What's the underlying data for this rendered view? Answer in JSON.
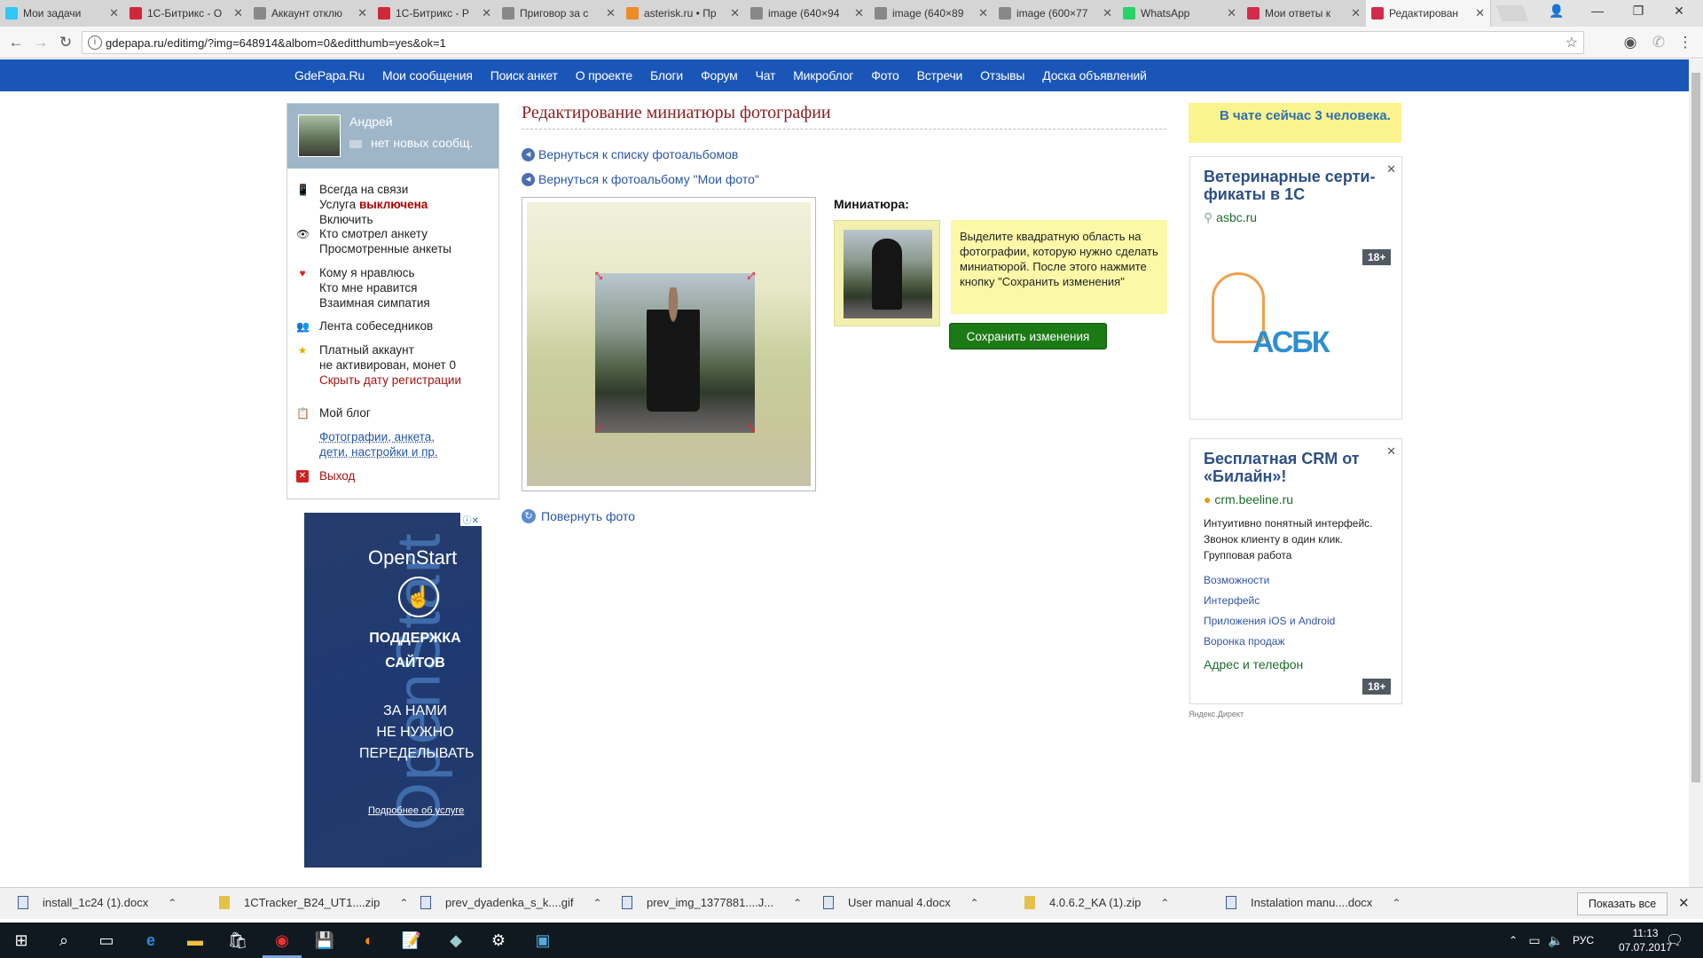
{
  "browser": {
    "tabs": [
      {
        "label": "Мои задачи",
        "icon": "bitrix24-icon",
        "color": "#2fc7f7"
      },
      {
        "label": "1С-Битрикс - О",
        "icon": "bitrix-icon",
        "color": "#d0283a"
      },
      {
        "label": "Аккаунт отклю",
        "icon": "page-icon",
        "color": "#888888"
      },
      {
        "label": "1С-Битрикс - Р",
        "icon": "bitrix-icon",
        "color": "#d0283a"
      },
      {
        "label": "Приговор за с",
        "icon": "page-icon",
        "color": "#888888"
      },
      {
        "label": "asterisk.ru • Пр",
        "icon": "asterisk-icon",
        "color": "#f08a24"
      },
      {
        "label": "image (640×94",
        "icon": "page-icon",
        "color": "#888888"
      },
      {
        "label": "image (640×89",
        "icon": "page-icon",
        "color": "#888888"
      },
      {
        "label": "image (600×77",
        "icon": "page-icon",
        "color": "#888888"
      },
      {
        "label": "WhatsApp",
        "icon": "whatsapp-icon",
        "color": "#25d366"
      },
      {
        "label": "Мои ответы к",
        "icon": "heart-icon",
        "color": "#d42b4c"
      },
      {
        "label": "Редактирован",
        "icon": "heart-icon",
        "color": "#d42b4c"
      }
    ],
    "url": "gdepapa.ru/editimg/?img=648914&albom=0&editthumb=yes&ok=1"
  },
  "topnav": [
    "GdePapa.Ru",
    "Мои сообщения",
    "Поиск анкет",
    "О проекте",
    "Блоги",
    "Форум",
    "Чат",
    "Микроблог",
    "Фото",
    "Встречи",
    "Отзывы",
    "Доска объявлений"
  ],
  "user": {
    "name": "Андрей",
    "messages": "нет новых сообщ."
  },
  "sidebar": {
    "always_online": "Всегда на связи",
    "service_prefix": "Услуга",
    "service_status": "выключена",
    "enable": "Включить",
    "who_viewed": "Кто смотрел анкету",
    "viewed_profiles": "Просмотренные анкеты",
    "who_likes_me": "Кому я нравлюсь",
    "who_i_like": "Кто мне нравится",
    "mutual": "Взаимная симпатия",
    "feed": "Лента собеседников",
    "paid_account": "Платный аккаунт",
    "not_activated": "не активирован",
    "coins": ", монет 0",
    "hide_date": "Скрыть дату регистрации",
    "my_blog": "Мой блог",
    "photos_link_1": "Фотографии, анкета,",
    "photos_link_2": "дети, настройки и пр.",
    "logout": "Выход"
  },
  "main": {
    "title": "Редактирование миниатюры фотографии",
    "back_albums": "Вернуться к списку фотоальбомов",
    "back_album": "Вернуться к фотоальбому \"Мои фото\"",
    "thumb_label": "Миниатюра:",
    "hint": "Выделите квадратную область на фотографии, которую нужно сделать миниатюрой. После этого нажмите кнопку \"Сохранить изменения\"",
    "save": "Сохранить изменения",
    "rotate": "Повернуть фото"
  },
  "chat_status": "В чате сейчас 3 человека.",
  "ads": {
    "ad1": {
      "title": "Ветеринарные серти-фикаты в 1С",
      "domain": "asbc.ru",
      "logo": "АСБК",
      "age": "18+"
    },
    "ad2": {
      "title": "Бесплатная CRM от «Билайн»!",
      "domain": "crm.beeline.ru",
      "text": "Интуитивно понятный интерфейс. Звонок клиенту в один клик. Групповая работа",
      "links": [
        "Возможности",
        "Интерфейс",
        "Приложения iOS и Android",
        "Воронка продаж"
      ],
      "contact": "Адрес и телефон",
      "age": "18+"
    },
    "yandex": "Яндекс.Директ",
    "left_banner": {
      "brand": "OpenStart",
      "line1": "ПОДДЕРЖКА",
      "line2": "САЙТОВ",
      "line3": "ЗА НАМИ",
      "line4": "НЕ НУЖНО",
      "line5": "ПЕРЕДЕЛЫВАТЬ",
      "more": "Подробнее об услуге",
      "vertical": "OpenStart"
    }
  },
  "downloads": [
    {
      "name": "install_1c24 (1).docx",
      "type": "doc"
    },
    {
      "name": "1CTracker_B24_UT1....zip",
      "type": "zip"
    },
    {
      "name": "prev_dyadenka_s_k....gif",
      "type": "doc"
    },
    {
      "name": "prev_img_1377881....J...",
      "type": "doc"
    },
    {
      "name": "User manual 4.docx",
      "type": "doc"
    },
    {
      "name": "4.0.6.2_KA (1).zip",
      "type": "zip"
    },
    {
      "name": "Instalation manu....docx",
      "type": "doc"
    }
  ],
  "show_all": "Показать все",
  "tray": {
    "lang": "РУС",
    "time": "11:13",
    "date": "07.07.2017"
  }
}
